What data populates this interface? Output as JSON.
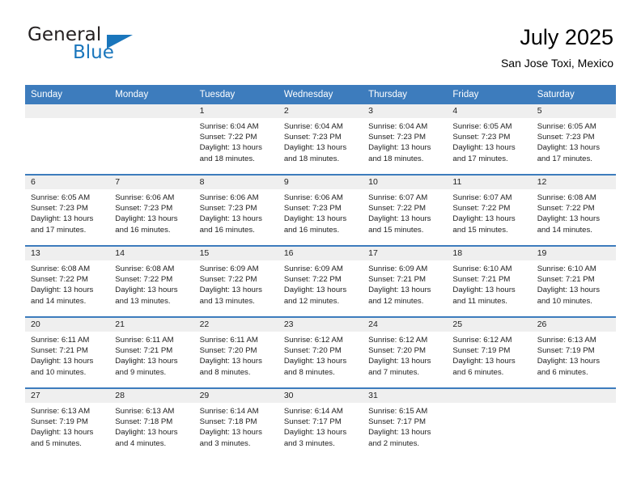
{
  "brand": {
    "name_primary": "General",
    "name_secondary": "Blue",
    "flag_icon": "triangle-flag-icon",
    "accent_color": "#1a76bc"
  },
  "header": {
    "title": "July 2025",
    "subtitle": "San Jose Toxi, Mexico"
  },
  "calendar": {
    "header_color": "#3d7cbd",
    "daynum_band_color": "#efefef",
    "weekday_headers": [
      "Sunday",
      "Monday",
      "Tuesday",
      "Wednesday",
      "Thursday",
      "Friday",
      "Saturday"
    ],
    "weeks": [
      [
        {
          "day": "",
          "lines": []
        },
        {
          "day": "",
          "lines": []
        },
        {
          "day": "1",
          "lines": [
            "Sunrise: 6:04 AM",
            "Sunset: 7:22 PM",
            "Daylight: 13 hours",
            "and 18 minutes."
          ]
        },
        {
          "day": "2",
          "lines": [
            "Sunrise: 6:04 AM",
            "Sunset: 7:23 PM",
            "Daylight: 13 hours",
            "and 18 minutes."
          ]
        },
        {
          "day": "3",
          "lines": [
            "Sunrise: 6:04 AM",
            "Sunset: 7:23 PM",
            "Daylight: 13 hours",
            "and 18 minutes."
          ]
        },
        {
          "day": "4",
          "lines": [
            "Sunrise: 6:05 AM",
            "Sunset: 7:23 PM",
            "Daylight: 13 hours",
            "and 17 minutes."
          ]
        },
        {
          "day": "5",
          "lines": [
            "Sunrise: 6:05 AM",
            "Sunset: 7:23 PM",
            "Daylight: 13 hours",
            "and 17 minutes."
          ]
        }
      ],
      [
        {
          "day": "6",
          "lines": [
            "Sunrise: 6:05 AM",
            "Sunset: 7:23 PM",
            "Daylight: 13 hours",
            "and 17 minutes."
          ]
        },
        {
          "day": "7",
          "lines": [
            "Sunrise: 6:06 AM",
            "Sunset: 7:23 PM",
            "Daylight: 13 hours",
            "and 16 minutes."
          ]
        },
        {
          "day": "8",
          "lines": [
            "Sunrise: 6:06 AM",
            "Sunset: 7:23 PM",
            "Daylight: 13 hours",
            "and 16 minutes."
          ]
        },
        {
          "day": "9",
          "lines": [
            "Sunrise: 6:06 AM",
            "Sunset: 7:23 PM",
            "Daylight: 13 hours",
            "and 16 minutes."
          ]
        },
        {
          "day": "10",
          "lines": [
            "Sunrise: 6:07 AM",
            "Sunset: 7:22 PM",
            "Daylight: 13 hours",
            "and 15 minutes."
          ]
        },
        {
          "day": "11",
          "lines": [
            "Sunrise: 6:07 AM",
            "Sunset: 7:22 PM",
            "Daylight: 13 hours",
            "and 15 minutes."
          ]
        },
        {
          "day": "12",
          "lines": [
            "Sunrise: 6:08 AM",
            "Sunset: 7:22 PM",
            "Daylight: 13 hours",
            "and 14 minutes."
          ]
        }
      ],
      [
        {
          "day": "13",
          "lines": [
            "Sunrise: 6:08 AM",
            "Sunset: 7:22 PM",
            "Daylight: 13 hours",
            "and 14 minutes."
          ]
        },
        {
          "day": "14",
          "lines": [
            "Sunrise: 6:08 AM",
            "Sunset: 7:22 PM",
            "Daylight: 13 hours",
            "and 13 minutes."
          ]
        },
        {
          "day": "15",
          "lines": [
            "Sunrise: 6:09 AM",
            "Sunset: 7:22 PM",
            "Daylight: 13 hours",
            "and 13 minutes."
          ]
        },
        {
          "day": "16",
          "lines": [
            "Sunrise: 6:09 AM",
            "Sunset: 7:22 PM",
            "Daylight: 13 hours",
            "and 12 minutes."
          ]
        },
        {
          "day": "17",
          "lines": [
            "Sunrise: 6:09 AM",
            "Sunset: 7:21 PM",
            "Daylight: 13 hours",
            "and 12 minutes."
          ]
        },
        {
          "day": "18",
          "lines": [
            "Sunrise: 6:10 AM",
            "Sunset: 7:21 PM",
            "Daylight: 13 hours",
            "and 11 minutes."
          ]
        },
        {
          "day": "19",
          "lines": [
            "Sunrise: 6:10 AM",
            "Sunset: 7:21 PM",
            "Daylight: 13 hours",
            "and 10 minutes."
          ]
        }
      ],
      [
        {
          "day": "20",
          "lines": [
            "Sunrise: 6:11 AM",
            "Sunset: 7:21 PM",
            "Daylight: 13 hours",
            "and 10 minutes."
          ]
        },
        {
          "day": "21",
          "lines": [
            "Sunrise: 6:11 AM",
            "Sunset: 7:21 PM",
            "Daylight: 13 hours",
            "and 9 minutes."
          ]
        },
        {
          "day": "22",
          "lines": [
            "Sunrise: 6:11 AM",
            "Sunset: 7:20 PM",
            "Daylight: 13 hours",
            "and 8 minutes."
          ]
        },
        {
          "day": "23",
          "lines": [
            "Sunrise: 6:12 AM",
            "Sunset: 7:20 PM",
            "Daylight: 13 hours",
            "and 8 minutes."
          ]
        },
        {
          "day": "24",
          "lines": [
            "Sunrise: 6:12 AM",
            "Sunset: 7:20 PM",
            "Daylight: 13 hours",
            "and 7 minutes."
          ]
        },
        {
          "day": "25",
          "lines": [
            "Sunrise: 6:12 AM",
            "Sunset: 7:19 PM",
            "Daylight: 13 hours",
            "and 6 minutes."
          ]
        },
        {
          "day": "26",
          "lines": [
            "Sunrise: 6:13 AM",
            "Sunset: 7:19 PM",
            "Daylight: 13 hours",
            "and 6 minutes."
          ]
        }
      ],
      [
        {
          "day": "27",
          "lines": [
            "Sunrise: 6:13 AM",
            "Sunset: 7:19 PM",
            "Daylight: 13 hours",
            "and 5 minutes."
          ]
        },
        {
          "day": "28",
          "lines": [
            "Sunrise: 6:13 AM",
            "Sunset: 7:18 PM",
            "Daylight: 13 hours",
            "and 4 minutes."
          ]
        },
        {
          "day": "29",
          "lines": [
            "Sunrise: 6:14 AM",
            "Sunset: 7:18 PM",
            "Daylight: 13 hours",
            "and 3 minutes."
          ]
        },
        {
          "day": "30",
          "lines": [
            "Sunrise: 6:14 AM",
            "Sunset: 7:17 PM",
            "Daylight: 13 hours",
            "and 3 minutes."
          ]
        },
        {
          "day": "31",
          "lines": [
            "Sunrise: 6:15 AM",
            "Sunset: 7:17 PM",
            "Daylight: 13 hours",
            "and 2 minutes."
          ]
        },
        {
          "day": "",
          "lines": []
        },
        {
          "day": "",
          "lines": []
        }
      ]
    ]
  }
}
